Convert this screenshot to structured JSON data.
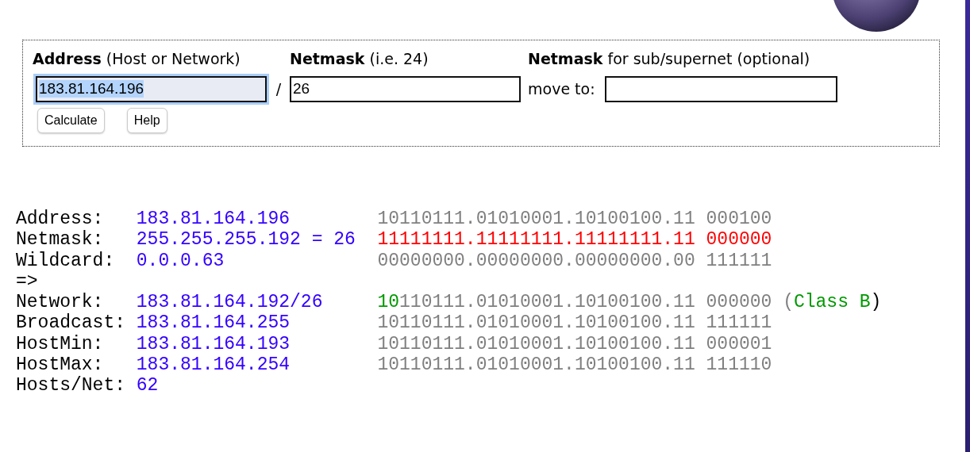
{
  "form": {
    "fields": [
      {
        "label_bold": "Address",
        "label_rest": "(Host or Network)",
        "value": "183.81.164.196",
        "focused": true
      },
      {
        "label_bold": "Netmask",
        "label_rest": "(i.e. 24)",
        "value": "26",
        "focused": false
      },
      {
        "label_bold": "Netmask",
        "label_rest": "for sub/supernet (optional)",
        "prefix": "move to:",
        "focused": false
      }
    ],
    "separator": "/",
    "buttons": [
      "Calculate",
      "Help"
    ]
  },
  "results": [
    {
      "label": "Address:",
      "value": "183.81.164.196",
      "bits": [
        {
          "text": "10110111.01010001.10100100.11 000100",
          "color": "#808080"
        }
      ]
    },
    {
      "label": "Netmask:",
      "value": "255.255.255.192 = 26",
      "bits": [
        {
          "text": "11111111.11111111.11111111.11 000000",
          "color": "#ff0000"
        }
      ]
    },
    {
      "label": "Wildcard:",
      "value": "0.0.0.63",
      "bits": [
        {
          "text": "00000000.00000000.00000000.00 111111",
          "color": "#808080"
        }
      ]
    },
    {
      "label": "=>"
    },
    {
      "label": "Network:",
      "value": "183.81.164.192/26",
      "bits": [
        {
          "text": "10",
          "color": "#009900"
        },
        {
          "text": "110111.01010001.10100100.11 000000",
          "color": "#808080"
        }
      ],
      "note": [
        {
          "text": "(",
          "color": "#808080"
        },
        {
          "text": "Class B",
          "color": "#009900"
        },
        {
          "text": ")",
          "color": "#000000"
        }
      ]
    },
    {
      "label": "Broadcast:",
      "value": "183.81.164.255",
      "bits": [
        {
          "text": "10110111.01010001.10100100.11 111111",
          "color": "#808080"
        }
      ]
    },
    {
      "label": "HostMin:",
      "value": "183.81.164.193",
      "bits": [
        {
          "text": "10110111.01010001.10100100.11 000001",
          "color": "#808080"
        }
      ]
    },
    {
      "label": "HostMax:",
      "value": "183.81.164.254",
      "bits": [
        {
          "text": "10110111.01010001.10100100.11 111110",
          "color": "#808080"
        }
      ]
    },
    {
      "label": "Hosts/Net:",
      "value": "62"
    }
  ]
}
